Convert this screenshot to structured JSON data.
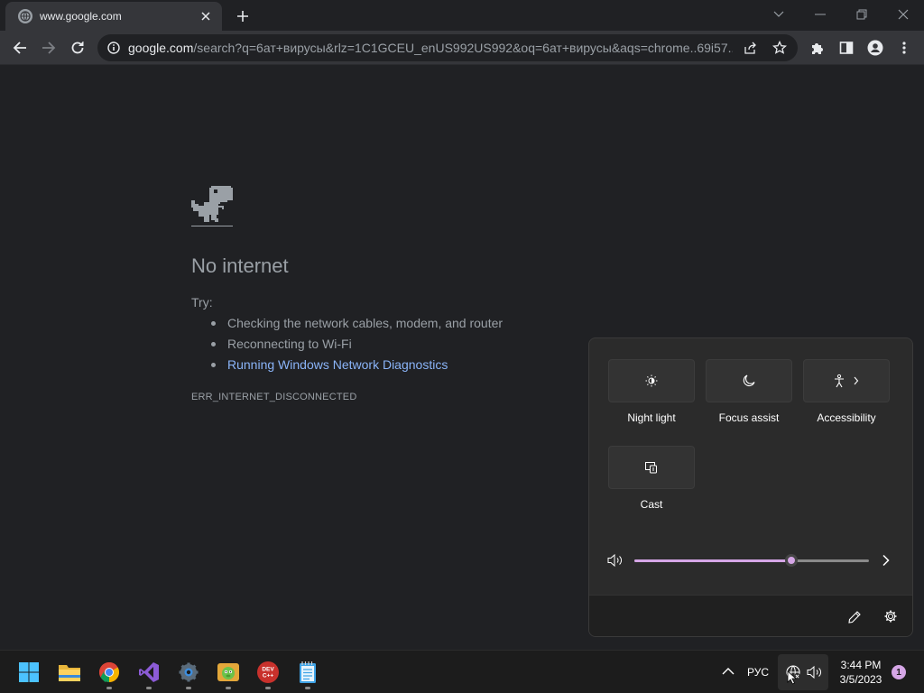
{
  "browser": {
    "tab": {
      "title": "www.google.com",
      "close_icon": "close-icon"
    },
    "new_tab_icon": "plus-icon",
    "window_controls": [
      "chevron-down-icon",
      "minimize-icon",
      "restore-icon",
      "close-icon"
    ],
    "omnibox": {
      "url_host": "google.com",
      "url_rest": "/search?q=6ат+вирусы&rlz=1C1GCEU_enUS992US992&oq=6ат+вирусы&aqs=chrome..69i57..."
    }
  },
  "page": {
    "title": "No internet",
    "try_label": "Try:",
    "suggestions": [
      "Checking the network cables, modem, and router",
      "Reconnecting to Wi-Fi",
      "Running Windows Network Diagnostics"
    ],
    "error_code": "ERR_INTERNET_DISCONNECTED"
  },
  "quick_settings": {
    "tiles": [
      {
        "label": "Night light",
        "icon": "brightness-icon"
      },
      {
        "label": "Focus assist",
        "icon": "moon-icon"
      },
      {
        "label": "Accessibility",
        "icon": "accessibility-icon"
      },
      {
        "label": "Cast",
        "icon": "cast-icon"
      }
    ],
    "volume_level": 0.67,
    "accent": "#d5a6e6"
  },
  "taskbar": {
    "apps": [
      "start",
      "file-explorer",
      "chrome",
      "visual-studio",
      "settings",
      "game",
      "dev-cpp",
      "notepad"
    ],
    "devcpp_label": "DEV C++",
    "language": "РУС",
    "time": "3:44 PM",
    "date": "3/5/2023",
    "notification_count": "1"
  }
}
